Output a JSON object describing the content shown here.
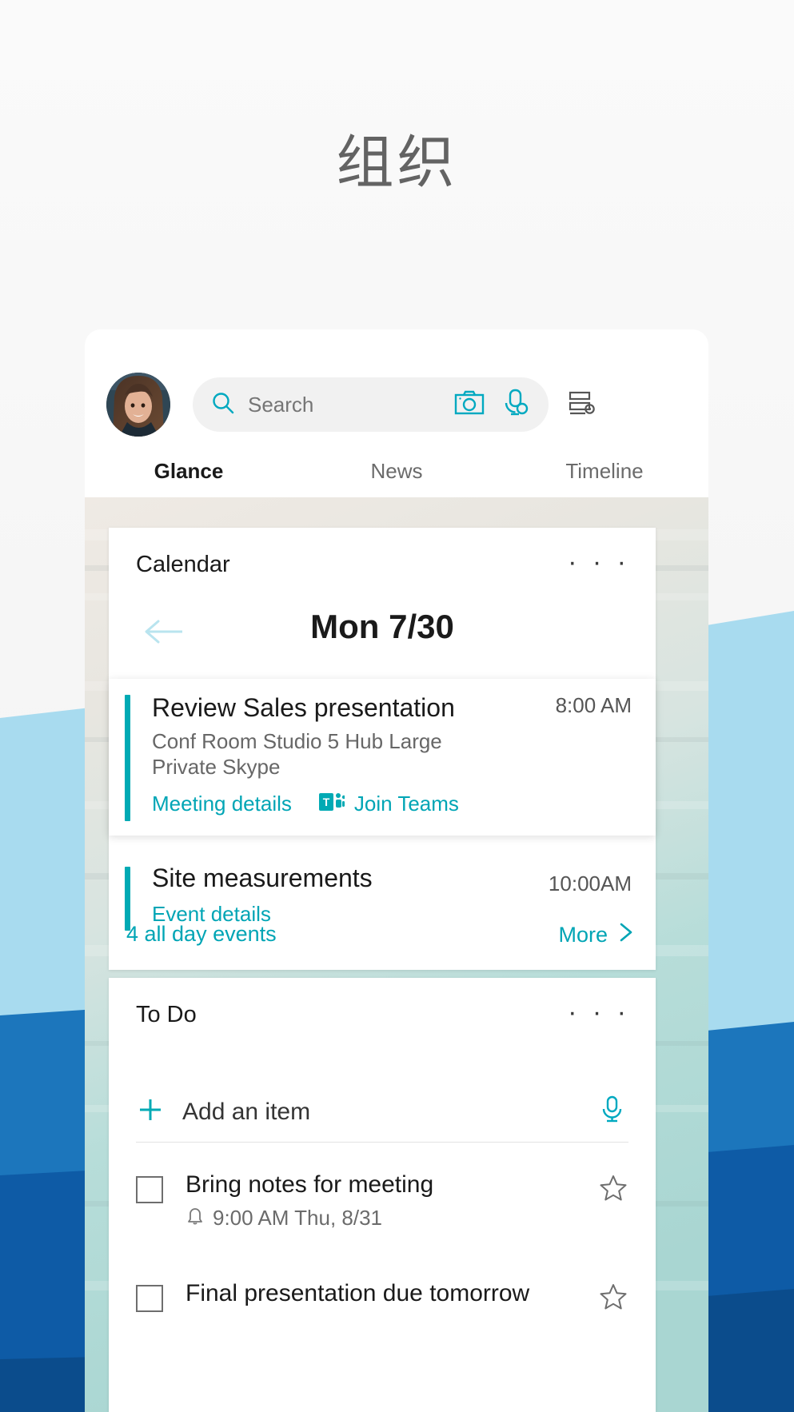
{
  "page": {
    "title": "组织"
  },
  "colors": {
    "accent_teal": "#00b0b9",
    "link_teal": "#00a5b5",
    "event_bar": "#00aab4",
    "wave_light_blue": "#a8dbef",
    "wave_mid_blue": "#1c76bc",
    "wave_dark_blue": "#0e5ba6",
    "wave_darkest_blue": "#0b4c8c",
    "page_bg": "#f4f4f4",
    "title_gray": "#636363"
  },
  "header": {
    "avatar_name": "user-avatar",
    "search": {
      "placeholder": "Search",
      "value": "",
      "icon": "search-icon",
      "camera_icon": "camera-icon",
      "mic_icon": "voice-mic-icon"
    },
    "settings_icon": "list-settings-icon"
  },
  "tabs": [
    {
      "label": "Glance",
      "active": true
    },
    {
      "label": "News",
      "active": false
    },
    {
      "label": "Timeline",
      "active": false
    }
  ],
  "calendar_card": {
    "title": "Calendar",
    "overflow_label": "· · ·",
    "back_icon": "arrow-left-icon",
    "date_label": "Mon 7/30",
    "events": [
      {
        "title": "Review Sales presentation",
        "location": "Conf Room Studio 5 Hub Large Private Skype",
        "time": "8:00 AM",
        "details_link": "Meeting details",
        "join_link": "Join Teams",
        "join_icon": "teams-icon"
      },
      {
        "title": "Site measurements",
        "location": "",
        "time": "10:00AM",
        "details_link": "Event details",
        "join_link": "",
        "join_icon": ""
      }
    ],
    "all_day_label": "4 all day events",
    "more_label": "More",
    "more_icon": "chevron-right-icon"
  },
  "todo_card": {
    "title": "To Do",
    "overflow_label": "· · ·",
    "add_label": "Add an item",
    "add_icon": "plus-icon",
    "add_mic_icon": "mic-icon",
    "items": [
      {
        "text": "Bring notes for meeting",
        "reminder": "9:00 AM Thu, 8/31",
        "reminder_icon": "bell-icon",
        "star_icon": "star-icon",
        "checked": false
      },
      {
        "text": "Final presentation due tomorrow",
        "reminder": "",
        "reminder_icon": "",
        "star_icon": "star-icon",
        "checked": false
      }
    ]
  }
}
